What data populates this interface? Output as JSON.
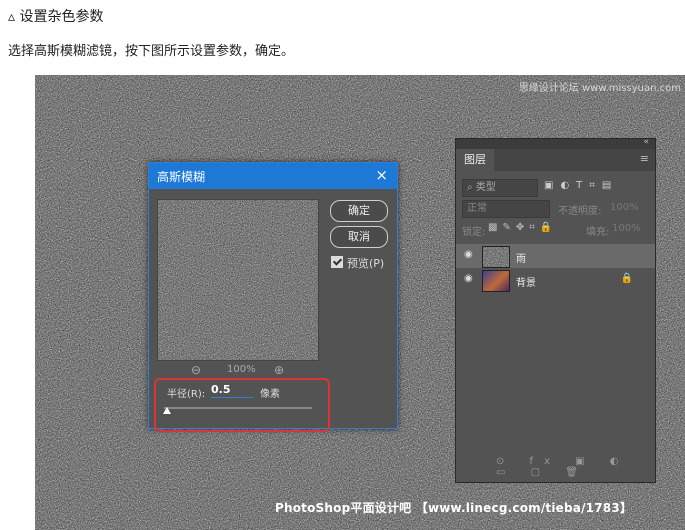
{
  "article": {
    "heading": "▵ 设置杂色参数",
    "instruction": "选择高斯模糊滤镜，按下图所示设置参数，确定。"
  },
  "watermarks": {
    "top": "思缘设计论坛 www.missyuan.com",
    "bottom": "PhotoShop平面设计吧 【www.linecg.com/tieba/1783】"
  },
  "dialog": {
    "title": "高斯模糊",
    "close_icon": "×",
    "ok_label": "确定",
    "cancel_label": "取消",
    "preview_label": "预览(P)",
    "preview_checked": true,
    "zoom_out_icon": "⊖",
    "zoom_level": "100%",
    "zoom_in_icon": "⊕",
    "radius_label": "半径(R):",
    "radius_value": "0.5",
    "radius_unit": "像素",
    "radius_slider_fraction": 0.02,
    "highlight_color": "#d93535"
  },
  "layers_panel": {
    "collapse_icon": "«",
    "tab": "图层",
    "menu_icon": "≡",
    "filter_type": "⌕ 类型",
    "filter_icons": "▣◐T⌗▤",
    "blend_mode": "正常",
    "opacity_label": "不透明度:",
    "opacity_value": "100%",
    "lock_label": "锁定:",
    "lock_icons": "▩✎✥⌗🔒",
    "fill_label": "填充:",
    "fill_value": "100%",
    "layers": [
      {
        "name": "雨",
        "visible": true,
        "selected": true
      },
      {
        "name": "背景",
        "visible": true,
        "selected": false,
        "locked": true
      }
    ],
    "eye_icon": "◉",
    "lock_icon": "🔒",
    "bottom_icons": "⊙ fx ▣ ◐ ▭ ▢ 🗑"
  }
}
